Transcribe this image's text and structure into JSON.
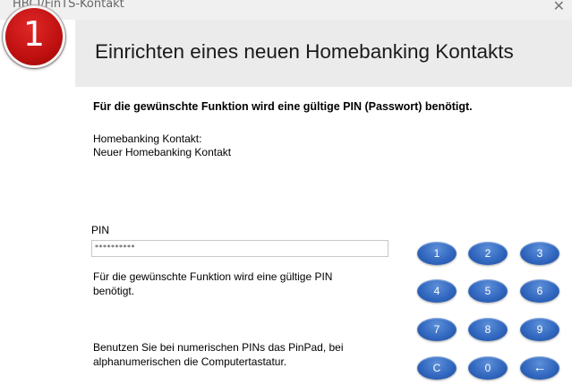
{
  "window": {
    "title": "HBCI/FinTS-Kontakt",
    "close_glyph": "✕"
  },
  "step_badge": "1",
  "header": {
    "title": "Einrichten eines neuen Homebanking Kontakts"
  },
  "content": {
    "bold_message": "Für die gewünschte Funktion wird eine gültige PIN (Passwort) benötigt.",
    "contact_label": "Homebanking Kontakt:",
    "contact_value": "Neuer Homebanking Kontakt",
    "pin_label": "PIN",
    "pin_value": "**********",
    "pin_hint_line1": "Für die gewünschte Funktion wird eine gültige PIN",
    "pin_hint_line2": "benötigt.",
    "pinpad_hint_line1": "Benutzen Sie bei numerischen PINs das PinPad, bei",
    "pinpad_hint_line2": "alphanumerischen die Computertastatur."
  },
  "pinpad": {
    "keys": [
      "1",
      "2",
      "3",
      "4",
      "5",
      "6",
      "7",
      "8",
      "9",
      "C",
      "0",
      "←"
    ]
  },
  "colors": {
    "badge": "#c01010",
    "pinpad_key": "#3268c0",
    "header_bg": "#ebebeb"
  },
  "icons": {
    "close": "close-icon",
    "backspace": "backspace-arrow-icon"
  }
}
